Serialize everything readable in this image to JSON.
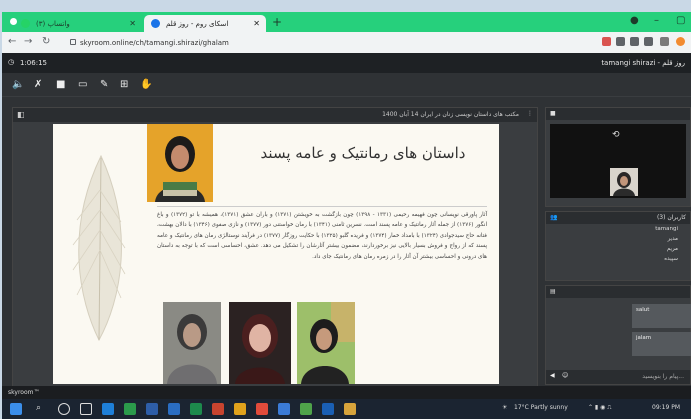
{
  "browser": {
    "tabs": [
      {
        "label": "(۳) واتساپ"
      },
      {
        "label": "اسکای روم - روز قلم"
      }
    ],
    "url": "skyroom.online/ch/tamangi.shirazi/ghalam"
  },
  "skyroom": {
    "timer": "1:06:15",
    "room_title": "tamangi shirazi - روز قلم",
    "presentation_title": "مکتب های داستان نویسی زنان در ایران 14 آبان 1400",
    "user_count_label": "کاربران (3)",
    "users": [
      "tamangi",
      "مدیر",
      "مریم",
      "سپیده"
    ],
    "chat_messages": [
      "salut",
      "jalam"
    ],
    "chat_placeholder": "پیام را بنویسید...",
    "status": "skyroom™"
  },
  "slide": {
    "title": "داستان های رمانتیک و عامه پسند",
    "body": "آثار پاورقی نویسانی چون فهیمه رحیمی (۱۳۳۱ - ۱۳۹۸) چون بازگشت به خویشتن (۱۳۷۱) و باران عشق (۱۳۷۱)، همیشه با تو (۱۳۷۲) و باغ انگور (۱۳۷۶) از جمله آثار رمانتیک و عامه پسند است. نسرین ثامنی (۱۳۴۱) با رمان خواستنی دور (۱۳۷۷) و نازی صفوی (۱۳۴۶) با دالان بهشت، فتانه حاج سیدجوادی (۱۳۲۴) با بامداد خمار (۱۳۷۴) و فریده گلبو (۱۳۲۵) با حکایت روزگار (۱۳۷۷) در فرآیند نوستالژی رمان های رمانتیک و عامه پسند که از رواج و فروش بسیار بالایی نیز برخوردارند، مضمون بیشتر آثارشان را تشکیل می دهد. عشق، احساسی است که با توجه به داستان های درونی و احساسی بیشتر آن آثار را در زمره رمان های رمانتیک جای داد."
  },
  "taskbar": {
    "weather": "17°C Partly sunny",
    "clock": "09:19 PM"
  },
  "colors": {
    "tabstrip": "#26d07c",
    "app_bg": "#2f3235",
    "panel_bg": "#3a3d40",
    "slide_bg": "#fbf9f2"
  }
}
